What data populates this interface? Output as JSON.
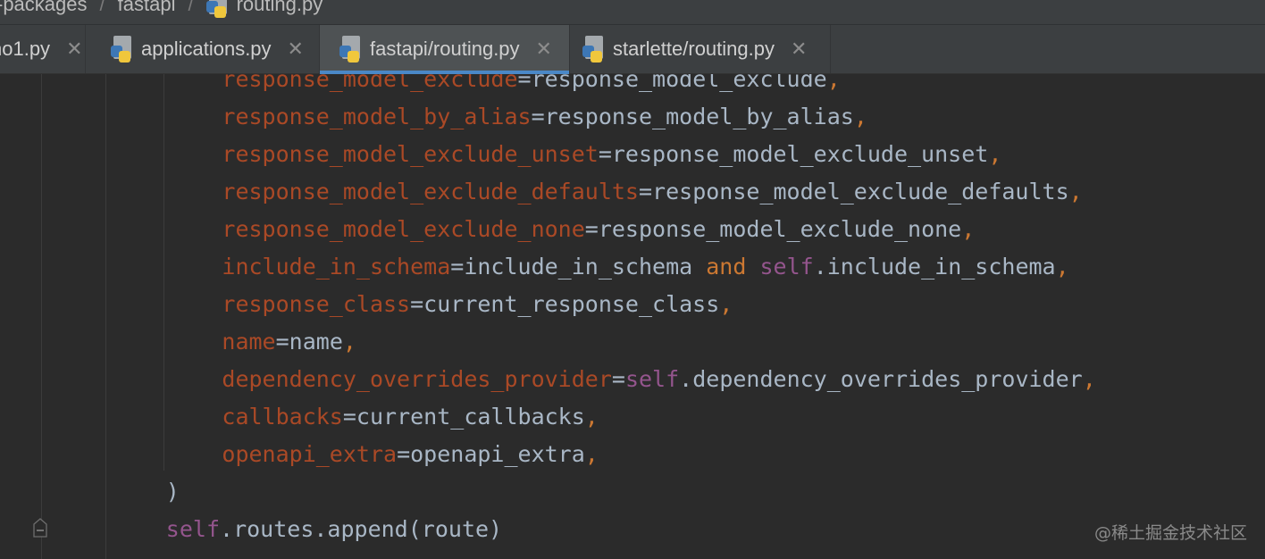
{
  "breadcrumb": {
    "items": [
      "-packages",
      "fastapi",
      "routing.py"
    ],
    "separator": "/"
  },
  "tabs": [
    {
      "label": "no1.py",
      "close": "✕",
      "active": false,
      "icon": "python-file-icon"
    },
    {
      "label": "applications.py",
      "close": "✕",
      "active": false,
      "icon": "python-file-icon"
    },
    {
      "label": "fastapi/routing.py",
      "close": "✕",
      "active": true,
      "icon": "python-file-icon"
    },
    {
      "label": "starlette/routing.py",
      "close": "✕",
      "active": false,
      "icon": "python-file-icon"
    }
  ],
  "colors": {
    "background": "#2b2b2b",
    "tabbar": "#3c3f41",
    "active_tab": "#4e5254",
    "active_underline": "#4a88c7",
    "param": "#aa4926",
    "plain": "#a9b7c6",
    "keyword": "#cc7832",
    "self": "#94558d"
  },
  "code": {
    "lines": [
      {
        "indent": 4,
        "tokens": [
          {
            "t": "response_model_exclude",
            "c": "param"
          },
          {
            "t": "=response_model_exclude",
            "c": "plain"
          },
          {
            "t": ",",
            "c": "kw"
          }
        ]
      },
      {
        "indent": 4,
        "tokens": [
          {
            "t": "response_model_by_alias",
            "c": "param"
          },
          {
            "t": "=response_model_by_alias",
            "c": "plain"
          },
          {
            "t": ",",
            "c": "kw"
          }
        ]
      },
      {
        "indent": 4,
        "tokens": [
          {
            "t": "response_model_exclude_unset",
            "c": "param"
          },
          {
            "t": "=response_model_exclude_unset",
            "c": "plain"
          },
          {
            "t": ",",
            "c": "kw"
          }
        ]
      },
      {
        "indent": 4,
        "tokens": [
          {
            "t": "response_model_exclude_defaults",
            "c": "param"
          },
          {
            "t": "=response_model_exclude_defaults",
            "c": "plain"
          },
          {
            "t": ",",
            "c": "kw"
          }
        ]
      },
      {
        "indent": 4,
        "tokens": [
          {
            "t": "response_model_exclude_none",
            "c": "param"
          },
          {
            "t": "=response_model_exclude_none",
            "c": "plain"
          },
          {
            "t": ",",
            "c": "kw"
          }
        ]
      },
      {
        "indent": 4,
        "tokens": [
          {
            "t": "include_in_schema",
            "c": "param"
          },
          {
            "t": "=include_in_schema ",
            "c": "plain"
          },
          {
            "t": "and",
            "c": "kw"
          },
          {
            "t": " ",
            "c": "plain"
          },
          {
            "t": "self",
            "c": "self"
          },
          {
            "t": ".include_in_schema",
            "c": "plain"
          },
          {
            "t": ",",
            "c": "kw"
          }
        ]
      },
      {
        "indent": 4,
        "tokens": [
          {
            "t": "response_class",
            "c": "param"
          },
          {
            "t": "=current_response_class",
            "c": "plain"
          },
          {
            "t": ",",
            "c": "kw"
          }
        ]
      },
      {
        "indent": 4,
        "tokens": [
          {
            "t": "name",
            "c": "param"
          },
          {
            "t": "=name",
            "c": "plain"
          },
          {
            "t": ",",
            "c": "kw"
          }
        ]
      },
      {
        "indent": 4,
        "tokens": [
          {
            "t": "dependency_overrides_provider",
            "c": "param"
          },
          {
            "t": "=",
            "c": "plain"
          },
          {
            "t": "self",
            "c": "self"
          },
          {
            "t": ".dependency_overrides_provider",
            "c": "plain"
          },
          {
            "t": ",",
            "c": "kw"
          }
        ]
      },
      {
        "indent": 4,
        "tokens": [
          {
            "t": "callbacks",
            "c": "param"
          },
          {
            "t": "=current_callbacks",
            "c": "plain"
          },
          {
            "t": ",",
            "c": "kw"
          }
        ]
      },
      {
        "indent": 4,
        "tokens": [
          {
            "t": "openapi_extra",
            "c": "param"
          },
          {
            "t": "=openapi_extra",
            "c": "plain"
          },
          {
            "t": ",",
            "c": "kw"
          }
        ]
      },
      {
        "indent": 3,
        "tokens": [
          {
            "t": ")",
            "c": "plain"
          }
        ]
      },
      {
        "indent": 3,
        "tokens": [
          {
            "t": "self",
            "c": "self"
          },
          {
            "t": ".routes.append(route)",
            "c": "plain"
          }
        ]
      }
    ]
  },
  "watermark": "@稀土掘金技术社区"
}
